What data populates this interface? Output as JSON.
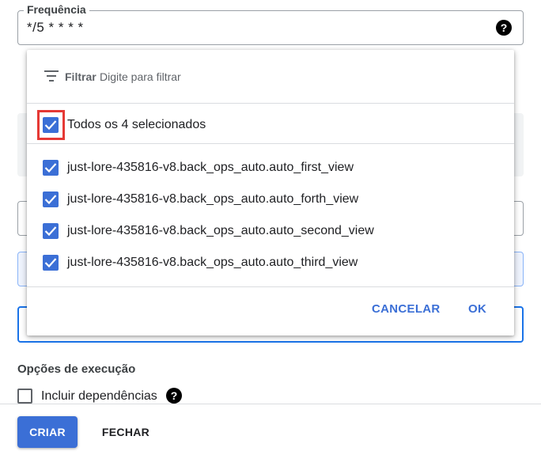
{
  "frequency": {
    "label": "Frequência",
    "value": "*/5 * * * *",
    "help_icon": "help-icon"
  },
  "picker": {
    "filter_label": "Filtrar",
    "filter_placeholder": "Digite para filtrar",
    "select_all_label": "Todos os 4 selecionados",
    "select_all_checked": true,
    "items": [
      {
        "label": "just-lore-435816-v8.back_ops_auto.auto_first_view",
        "checked": true
      },
      {
        "label": "just-lore-435816-v8.back_ops_auto.auto_forth_view",
        "checked": true
      },
      {
        "label": "just-lore-435816-v8.back_ops_auto.auto_second_view",
        "checked": true
      },
      {
        "label": "just-lore-435816-v8.back_ops_auto.auto_third_view",
        "checked": true
      }
    ],
    "cancel_label": "CANCELAR",
    "ok_label": "OK"
  },
  "execution": {
    "title": "Opções de execução",
    "include_deps_label": "Incluir dependências",
    "include_deps_checked": false
  },
  "footer": {
    "create_label": "CRIAR",
    "close_label": "FECHAR"
  },
  "colors": {
    "accent": "#3b6fd6",
    "highlight": "#e53935"
  }
}
